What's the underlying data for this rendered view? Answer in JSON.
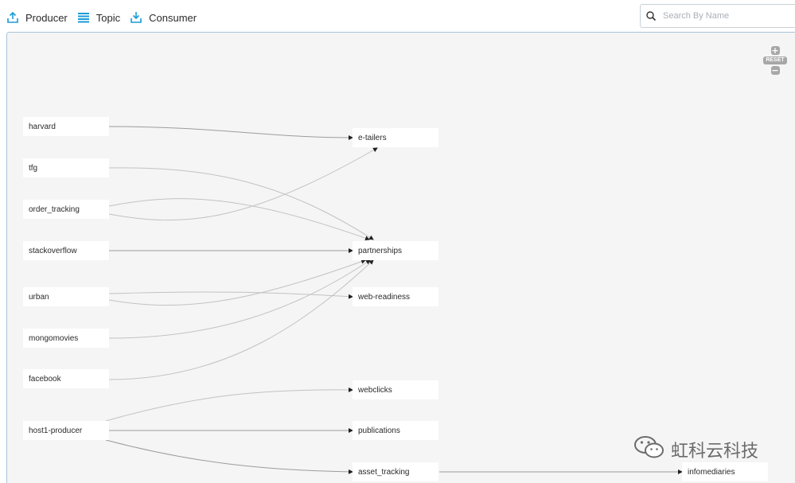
{
  "legend": {
    "producer": "Producer",
    "topic": "Topic",
    "consumer": "Consumer"
  },
  "search": {
    "placeholder": "Search By Name",
    "value": ""
  },
  "zoom": {
    "in": "+",
    "reset": "RESET",
    "out": "−"
  },
  "producers": [
    "harvard",
    "tfg",
    "order_tracking",
    "stackoverflow",
    "urban",
    "mongomovies",
    "facebook",
    "host1-producer"
  ],
  "topics": [
    "e-tailers",
    "partnerships",
    "web-readiness",
    "webclicks",
    "publications",
    "asset_tracking"
  ],
  "consumers": [
    "infomediaries"
  ],
  "watermark": {
    "text": "虹科云科技"
  },
  "colors": {
    "canvas_bg": "#f5f5f5",
    "canvas_border": "#a9c3d9",
    "legend_icon": "#1a9bd7",
    "edge": "#c2c2c2"
  }
}
